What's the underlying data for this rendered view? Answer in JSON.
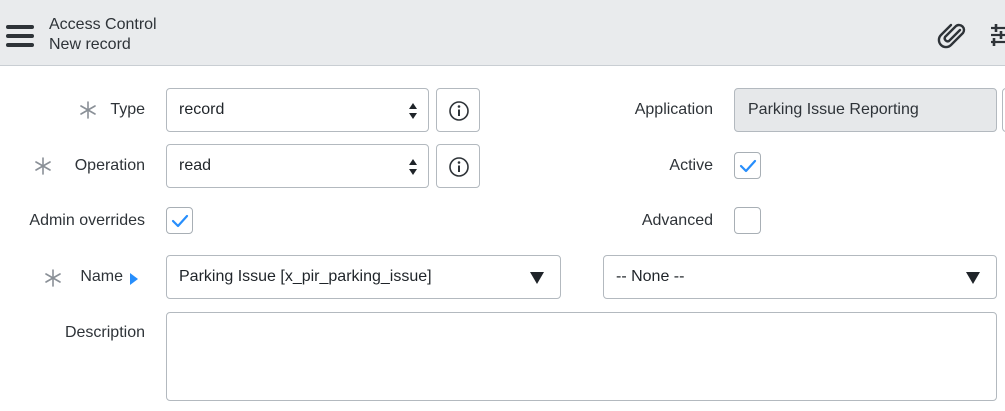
{
  "header": {
    "title": "Access Control",
    "subtitle": "New record",
    "icons": [
      "menu-icon",
      "paperclip-icon",
      "sliders-icon"
    ]
  },
  "form": {
    "type": {
      "label": "Type",
      "value": "record",
      "required": true
    },
    "operation": {
      "label": "Operation",
      "value": "read",
      "required": true
    },
    "admin_overrides": {
      "label": "Admin overrides",
      "checked": true
    },
    "name": {
      "label": "Name",
      "value": "Parking Issue [x_pir_parking_issue]",
      "required": true,
      "field_value": "-- None --"
    },
    "description": {
      "label": "Description",
      "value": ""
    },
    "application": {
      "label": "Application",
      "value": "Parking Issue Reporting"
    },
    "active": {
      "label": "Active",
      "checked": true
    },
    "advanced": {
      "label": "Advanced",
      "checked": false
    }
  },
  "colors": {
    "header_bg": "#e9ebed",
    "accent_blue": "#278efc",
    "readonly_bg": "#e6e8ea",
    "border": "#b3b9bf"
  }
}
